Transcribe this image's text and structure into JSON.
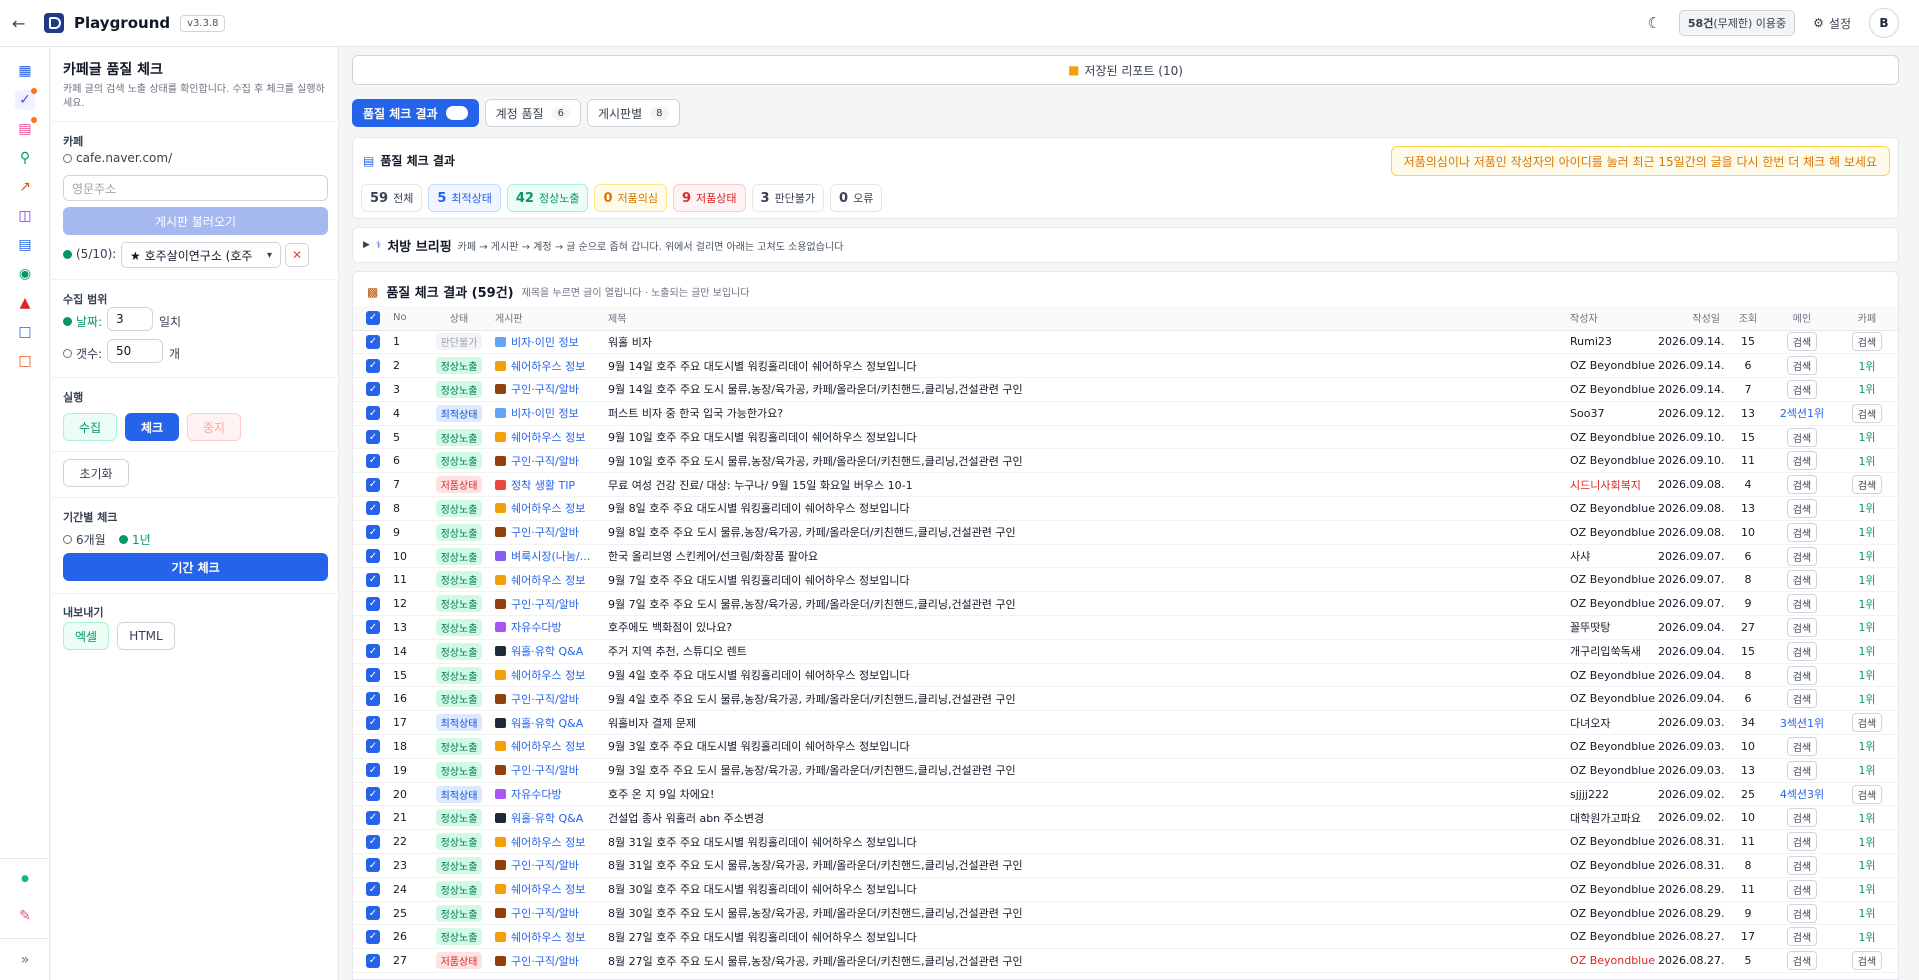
{
  "app": {
    "title": "Playground",
    "version": "v3.3.8",
    "usage_count": "58건",
    "usage_note": "(무제한) 이용중",
    "settings": "설정",
    "avatar": "B"
  },
  "panel": {
    "title": "카페글 품질 체크",
    "desc": "카페 글의 검색 노출 상태를 확인합니다. 수집 후 체크를 실행하세요.",
    "cafe_label": "카페",
    "cafe_prefix": "cafe.naver.com/",
    "cafe_placeholder": "영문주소",
    "load_board": "게시판 불러오기",
    "cafe_count": "(5/10):",
    "cafe_selected": "★ 호주살이연구소 (호주",
    "range_label": "수집 범위",
    "date_label": "날짜:",
    "date_value": "3",
    "date_unit": "일치",
    "count_label": "갯수:",
    "count_value": "50",
    "count_unit": "개",
    "run_label": "실행",
    "collect": "수집",
    "check": "체크",
    "stop": "중지",
    "reset": "초기화",
    "period_label": "기간별 체크",
    "period_6m": "6개월",
    "period_1y": "1년",
    "period_btn": "기간 체크",
    "export_label": "내보내기",
    "excel": "엑셀",
    "html": "HTML"
  },
  "main": {
    "saved_reports": "저장된 리포트 (10)",
    "tabs": [
      {
        "label": "품질 체크 결과",
        "count": ""
      },
      {
        "label": "계정 품질",
        "count": "6"
      },
      {
        "label": "게시판별",
        "count": "8"
      }
    ],
    "summary_title": "품질 체크 결과",
    "warning": "저품의심이나 저품인 작성자의 아이디를 눌러 최근 15일간의 글을 다시 한번 더 체크 해 보세요",
    "stats": [
      {
        "num": "59",
        "label": "전체"
      },
      {
        "num": "5",
        "label": "최적상태"
      },
      {
        "num": "42",
        "label": "정상노출"
      },
      {
        "num": "0",
        "label": "저품의심"
      },
      {
        "num": "9",
        "label": "저품상태"
      },
      {
        "num": "3",
        "label": "판단불가"
      },
      {
        "num": "0",
        "label": "오류"
      }
    ],
    "brief_title": "처방 브리핑",
    "brief_text": "카페 → 게시판 → 계정 → 글 순으로 좁혀 갑니다. 위에서 걸리면 아래는 고쳐도 소용없습니다",
    "table_title": "품질 체크 결과 (59건)",
    "table_sub": "제목을 누르면 글이 열립니다 · 노출되는 글만 보입니다",
    "columns": {
      "no": "No",
      "status": "상태",
      "board": "게시판",
      "title": "제목",
      "author": "작성자",
      "date": "작성일",
      "views": "조회",
      "main": "메인",
      "cafe": "카페"
    },
    "search": "검색",
    "rows": [
      {
        "no": "1",
        "status": "판단불가",
        "board": "비자·이민 정보",
        "title": "워홀 비자",
        "author": "Rumi23",
        "date": "2026.09.14.",
        "views": "15",
        "main": "검색",
        "cafe": "검색"
      },
      {
        "no": "2",
        "status": "정상노출",
        "board": "쉐어하우스 정보",
        "title": "9월 14일 호주 주요 대도시별 워킹홀리데이 쉐어하우스 정보입니다",
        "author": "OZ Beyondblue",
        "date": "2026.09.14.",
        "views": "6",
        "main": "검색",
        "cafe": "1위"
      },
      {
        "no": "3",
        "status": "정상노출",
        "board": "구인·구직/알바",
        "title": "9월 14일 호주 주요 도시 물류,농장/육가공, 카페/올라운더/키친핸드,클리닝,건설관련 구인",
        "author": "OZ Beyondblue",
        "date": "2026.09.14.",
        "views": "7",
        "main": "검색",
        "cafe": "1위"
      },
      {
        "no": "4",
        "status": "최적상태",
        "board": "비자·이민 정보",
        "title": "퍼스트 비자 중 한국 입국 가능한가요?",
        "author": "Soo37",
        "date": "2026.09.12.",
        "views": "13",
        "main": "2섹션1위",
        "cafe": "검색"
      },
      {
        "no": "5",
        "status": "정상노출",
        "board": "쉐어하우스 정보",
        "title": "9월 10일 호주 주요 대도시별 워킹홀리데이 쉐어하우스 정보입니다",
        "author": "OZ Beyondblue",
        "date": "2026.09.10.",
        "views": "15",
        "main": "검색",
        "cafe": "1위"
      },
      {
        "no": "6",
        "status": "정상노출",
        "board": "구인·구직/알바",
        "title": "9월 10일 호주 주요 도시 물류,농장/육가공, 카페/올라운더/키친핸드,클리닝,건설관련 구인",
        "author": "OZ Beyondblue",
        "date": "2026.09.10.",
        "views": "11",
        "main": "검색",
        "cafe": "1위"
      },
      {
        "no": "7",
        "status": "저품상태",
        "board": "정착 생활 TIP",
        "title": "무료 여성 건강 진료/ 대상: 누구나/ 9월 15일 화요일 버우스 10-1",
        "author": "시드니사회복지",
        "date": "2026.09.08.",
        "views": "4",
        "main": "검색",
        "cafe": "검색"
      },
      {
        "no": "8",
        "status": "정상노출",
        "board": "쉐어하우스 정보",
        "title": "9월 8일 호주 주요 대도시별 워킹홀리데이 쉐어하우스 정보입니다",
        "author": "OZ Beyondblue",
        "date": "2026.09.08.",
        "views": "13",
        "main": "검색",
        "cafe": "1위"
      },
      {
        "no": "9",
        "status": "정상노출",
        "board": "구인·구직/알바",
        "title": "9월 8일 호주 주요 도시 물류,농장/육가공, 카페/올라운더/키친핸드,클리닝,건설관련 구인",
        "author": "OZ Beyondblue",
        "date": "2026.09.08.",
        "views": "10",
        "main": "검색",
        "cafe": "1위"
      },
      {
        "no": "10",
        "status": "정상노출",
        "board": "벼룩시장(나눔/...",
        "title": "한국 올리브영 스킨케어/선크림/화장품 팔아요",
        "author": "사샤",
        "date": "2026.09.07.",
        "views": "6",
        "main": "검색",
        "cafe": "1위"
      },
      {
        "no": "11",
        "status": "정상노출",
        "board": "쉐어하우스 정보",
        "title": "9월 7일 호주 주요 대도시별 워킹홀리데이 쉐어하우스 정보입니다",
        "author": "OZ Beyondblue",
        "date": "2026.09.07.",
        "views": "8",
        "main": "검색",
        "cafe": "1위"
      },
      {
        "no": "12",
        "status": "정상노출",
        "board": "구인·구직/알바",
        "title": "9월 7일 호주 주요 도시 물류,농장/육가공, 카페/올라운더/키친핸드,클리닝,건설관련 구인",
        "author": "OZ Beyondblue",
        "date": "2026.09.07.",
        "views": "9",
        "main": "검색",
        "cafe": "1위"
      },
      {
        "no": "13",
        "status": "정상노출",
        "board": "자유수다방",
        "title": "호주에도 백화점이 있나요?",
        "author": "꼴뚜땃탕",
        "date": "2026.09.04.",
        "views": "27",
        "main": "검색",
        "cafe": "1위"
      },
      {
        "no": "14",
        "status": "정상노출",
        "board": "워홀·유학 Q&A",
        "title": "주거 지역 추천, 스튜디오 렌트",
        "author": "개구리입쑥독새",
        "date": "2026.09.04.",
        "views": "15",
        "main": "검색",
        "cafe": "1위"
      },
      {
        "no": "15",
        "status": "정상노출",
        "board": "쉐어하우스 정보",
        "title": "9월 4일 호주 주요 대도시별 워킹홀리데이 쉐어하우스 정보입니다",
        "author": "OZ Beyondblue",
        "date": "2026.09.04.",
        "views": "8",
        "main": "검색",
        "cafe": "1위"
      },
      {
        "no": "16",
        "status": "정상노출",
        "board": "구인·구직/알바",
        "title": "9월 4일 호주 주요 도시 물류,농장/육가공, 카페/올라운더/키친핸드,클리닝,건설관련 구인",
        "author": "OZ Beyondblue",
        "date": "2026.09.04.",
        "views": "6",
        "main": "검색",
        "cafe": "1위"
      },
      {
        "no": "17",
        "status": "최적상태",
        "board": "워홀·유학 Q&A",
        "title": "워홀비자 결제 문제",
        "author": "다녀오자",
        "date": "2026.09.03.",
        "views": "34",
        "main": "3섹션1위",
        "cafe": "검색"
      },
      {
        "no": "18",
        "status": "정상노출",
        "board": "쉐어하우스 정보",
        "title": "9월 3일 호주 주요 대도시별 워킹홀리데이 쉐어하우스 정보입니다",
        "author": "OZ Beyondblue",
        "date": "2026.09.03.",
        "views": "10",
        "main": "검색",
        "cafe": "1위"
      },
      {
        "no": "19",
        "status": "정상노출",
        "board": "구인·구직/알바",
        "title": "9월 3일 호주 주요 도시 물류,농장/육가공, 카페/올라운더/키친핸드,클리닝,건설관련 구인",
        "author": "OZ Beyondblue",
        "date": "2026.09.03.",
        "views": "13",
        "main": "검색",
        "cafe": "1위"
      },
      {
        "no": "20",
        "status": "최적상태",
        "board": "자유수다방",
        "title": "호주 온 지 9일 차에요!",
        "author": "sjjjj222",
        "date": "2026.09.02.",
        "views": "25",
        "main": "4섹션3위",
        "cafe": "검색"
      },
      {
        "no": "21",
        "status": "정상노출",
        "board": "워홀·유학 Q&A",
        "title": "건설업 종사 워홀러 abn 주소변경",
        "author": "대학원가고파요",
        "date": "2026.09.02.",
        "views": "10",
        "main": "검색",
        "cafe": "1위"
      },
      {
        "no": "22",
        "status": "정상노출",
        "board": "쉐어하우스 정보",
        "title": "8월 31일 호주 주요 대도시별 워킹홀리데이 쉐어하우스 정보입니다",
        "author": "OZ Beyondblue",
        "date": "2026.08.31.",
        "views": "11",
        "main": "검색",
        "cafe": "1위"
      },
      {
        "no": "23",
        "status": "정상노출",
        "board": "구인·구직/알바",
        "title": "8월 31일 호주 주요 도시 물류,농장/육가공, 카페/올라운더/키친핸드,클리닝,건설관련 구인",
        "author": "OZ Beyondblue",
        "date": "2026.08.31.",
        "views": "8",
        "main": "검색",
        "cafe": "1위"
      },
      {
        "no": "24",
        "status": "정상노출",
        "board": "쉐어하우스 정보",
        "title": "8월 30일 호주 주요 대도시별 워킹홀리데이 쉐어하우스 정보입니다",
        "author": "OZ Beyondblue",
        "date": "2026.08.29.",
        "views": "11",
        "main": "검색",
        "cafe": "1위"
      },
      {
        "no": "25",
        "status": "정상노출",
        "board": "구인·구직/알바",
        "title": "8월 30일 호주 주요 도시 물류,농장/육가공, 카페/올라운더/키친핸드,클리닝,건설관련 구인",
        "author": "OZ Beyondblue",
        "date": "2026.08.29.",
        "views": "9",
        "main": "검색",
        "cafe": "1위"
      },
      {
        "no": "26",
        "status": "정상노출",
        "board": "쉐어하우스 정보",
        "title": "8월 27일 호주 주요 대도시별 워킹홀리데이 쉐어하우스 정보입니다",
        "author": "OZ Beyondblue",
        "date": "2026.08.27.",
        "views": "17",
        "main": "검색",
        "cafe": "1위"
      },
      {
        "no": "27",
        "status": "저품상태",
        "board": "구인·구직/알바",
        "title": "8월 27일 호주 주요 도시 물류,농장/육가공, 카페/올라운더/키친핸드,클리닝,건설관련 구인",
        "author": "OZ Beyondblue",
        "date": "2026.08.27.",
        "views": "5",
        "main": "검색",
        "cafe": "검색"
      }
    ]
  },
  "colors": {
    "accent": "#2563eb",
    "normal": "#047857",
    "best": "#1d4ed8",
    "low": "#dc2626",
    "na": "#9ca3af"
  }
}
